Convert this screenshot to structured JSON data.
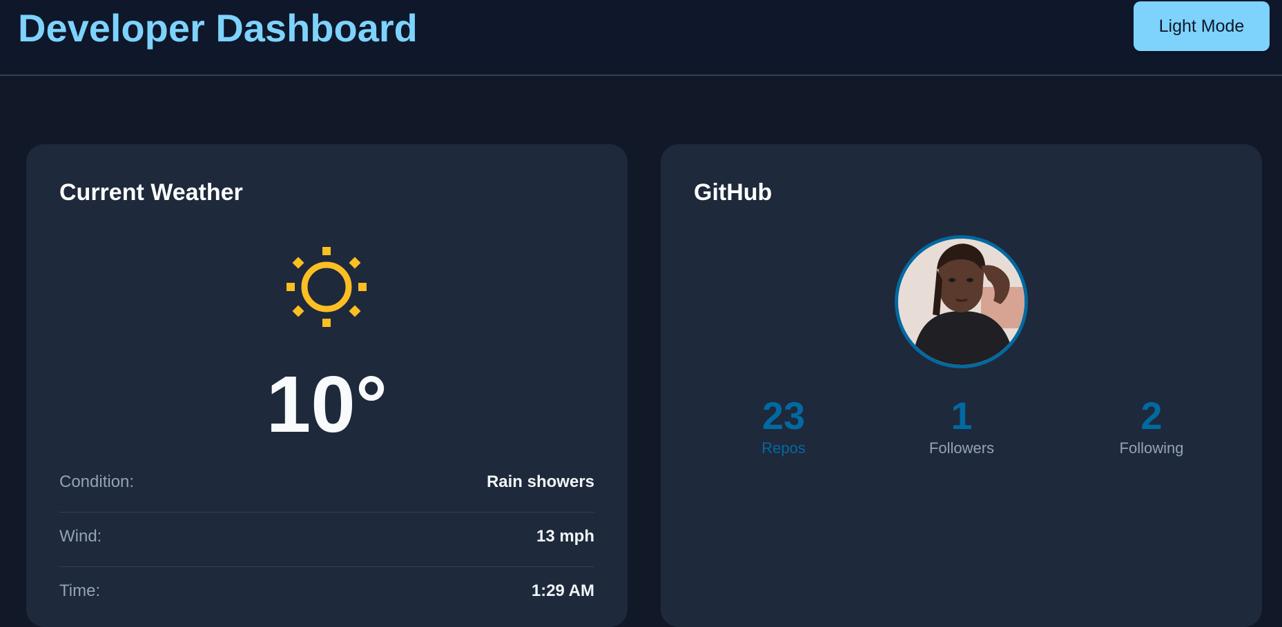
{
  "header": {
    "title": "Developer Dashboard",
    "theme_toggle_label": "Light Mode"
  },
  "weather": {
    "title": "Current Weather",
    "icon": "sun-icon",
    "temperature": "10°",
    "details": [
      {
        "label": "Condition:",
        "value": "Rain showers"
      },
      {
        "label": "Wind:",
        "value": "13 mph"
      },
      {
        "label": "Time:",
        "value": "1:29 AM"
      }
    ]
  },
  "github": {
    "title": "GitHub",
    "avatar": "user-avatar",
    "stats": [
      {
        "value": "23",
        "label": "Repos"
      },
      {
        "value": "1",
        "label": "Followers"
      },
      {
        "value": "2",
        "label": "Following"
      }
    ]
  },
  "colors": {
    "background": "#111827",
    "header": "#0f172a",
    "card": "#1e293b",
    "accent": "#7dd3fc",
    "stat_blue": "#0369a1",
    "sun": "#fbbf24"
  }
}
